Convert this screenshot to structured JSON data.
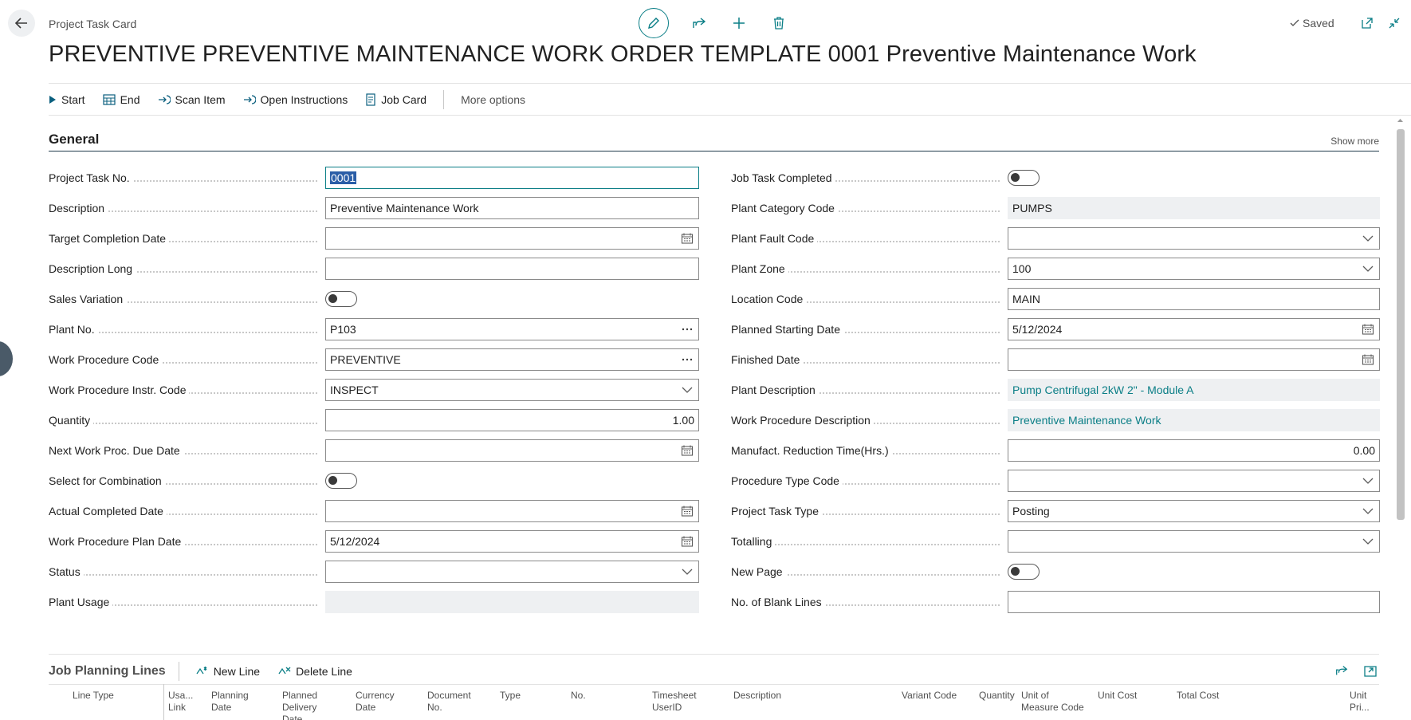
{
  "header": {
    "breadcrumb": "Project Task Card",
    "title": "PREVENTIVE PREVENTIVE MAINTENANCE WORK ORDER TEMPLATE 0001 Preventive Maintenance Work",
    "saved_label": "Saved"
  },
  "actions": {
    "start": "Start",
    "end": "End",
    "scan_item": "Scan Item",
    "open_instructions": "Open Instructions",
    "job_card": "Job Card",
    "more_options": "More options"
  },
  "general": {
    "title": "General",
    "show_more": "Show more",
    "left": [
      {
        "label": "Project Task No.",
        "value": "0001",
        "kind": "text",
        "focused": true
      },
      {
        "label": "Description",
        "value": "Preventive Maintenance Work",
        "kind": "text"
      },
      {
        "label": "Target Completion Date",
        "value": "",
        "kind": "date"
      },
      {
        "label": "Description Long",
        "value": "",
        "kind": "text"
      },
      {
        "label": "Sales Variation",
        "value": "off",
        "kind": "toggle"
      },
      {
        "label": "Plant No.",
        "value": "P103",
        "kind": "lookup"
      },
      {
        "label": "Work Procedure Code",
        "value": "PREVENTIVE",
        "kind": "lookup"
      },
      {
        "label": "Work Procedure Instr. Code",
        "value": "INSPECT",
        "kind": "dropdown"
      },
      {
        "label": "Quantity",
        "value": "1.00",
        "kind": "number"
      },
      {
        "label": "Next Work Proc. Due Date",
        "value": "",
        "kind": "date"
      },
      {
        "label": "Select for Combination",
        "value": "off",
        "kind": "toggle"
      },
      {
        "label": "Actual Completed Date",
        "value": "",
        "kind": "date"
      },
      {
        "label": "Work Procedure Plan Date",
        "value": "5/12/2024",
        "kind": "date"
      },
      {
        "label": "Status",
        "value": "",
        "kind": "dropdown"
      },
      {
        "label": "Plant Usage",
        "value": "",
        "kind": "readonly"
      }
    ],
    "right": [
      {
        "label": "Job Task Completed",
        "value": "off",
        "kind": "toggle"
      },
      {
        "label": "Plant Category Code",
        "value": "PUMPS",
        "kind": "readonly"
      },
      {
        "label": "Plant Fault Code",
        "value": "",
        "kind": "dropdown"
      },
      {
        "label": "Plant Zone",
        "value": "100",
        "kind": "dropdown"
      },
      {
        "label": "Location Code",
        "value": "MAIN",
        "kind": "text"
      },
      {
        "label": "Planned Starting Date",
        "value": "5/12/2024",
        "kind": "date"
      },
      {
        "label": "Finished Date",
        "value": "",
        "kind": "date"
      },
      {
        "label": "Plant Description",
        "value": "Pump Centrifugal 2kW 2\" - Module A",
        "kind": "readonly-link"
      },
      {
        "label": "Work Procedure Description",
        "value": "Preventive Maintenance Work",
        "kind": "readonly-link"
      },
      {
        "label": "Manufact. Reduction Time(Hrs.)",
        "value": "0.00",
        "kind": "number"
      },
      {
        "label": "Procedure Type Code",
        "value": "",
        "kind": "dropdown"
      },
      {
        "label": "Project Task Type",
        "value": "Posting",
        "kind": "dropdown"
      },
      {
        "label": "Totalling",
        "value": "",
        "kind": "dropdown"
      },
      {
        "label": "New Page",
        "value": "off",
        "kind": "toggle"
      },
      {
        "label": "No. of Blank Lines",
        "value": "",
        "kind": "text"
      }
    ]
  },
  "job_planning_lines": {
    "title": "Job Planning Lines",
    "new_line": "New Line",
    "delete_line": "Delete Line",
    "columns": [
      "Line Type",
      "Usa...\nLink",
      "Planning\nDate",
      "Planned\nDelivery\nDate",
      "Currency\nDate",
      "Document\nNo.",
      "Type",
      "No.",
      "Timesheet\nUserID",
      "Description",
      "Variant Code",
      "Quantity",
      "Unit of\nMeasure Code",
      "Unit Cost",
      "Total Cost",
      "Unit Pri..."
    ]
  },
  "colors": {
    "accent": "#0a7e86",
    "section_rule": "#1f3a4a",
    "readonly_bg": "#eef0f2",
    "selection": "#2b5ea7"
  }
}
